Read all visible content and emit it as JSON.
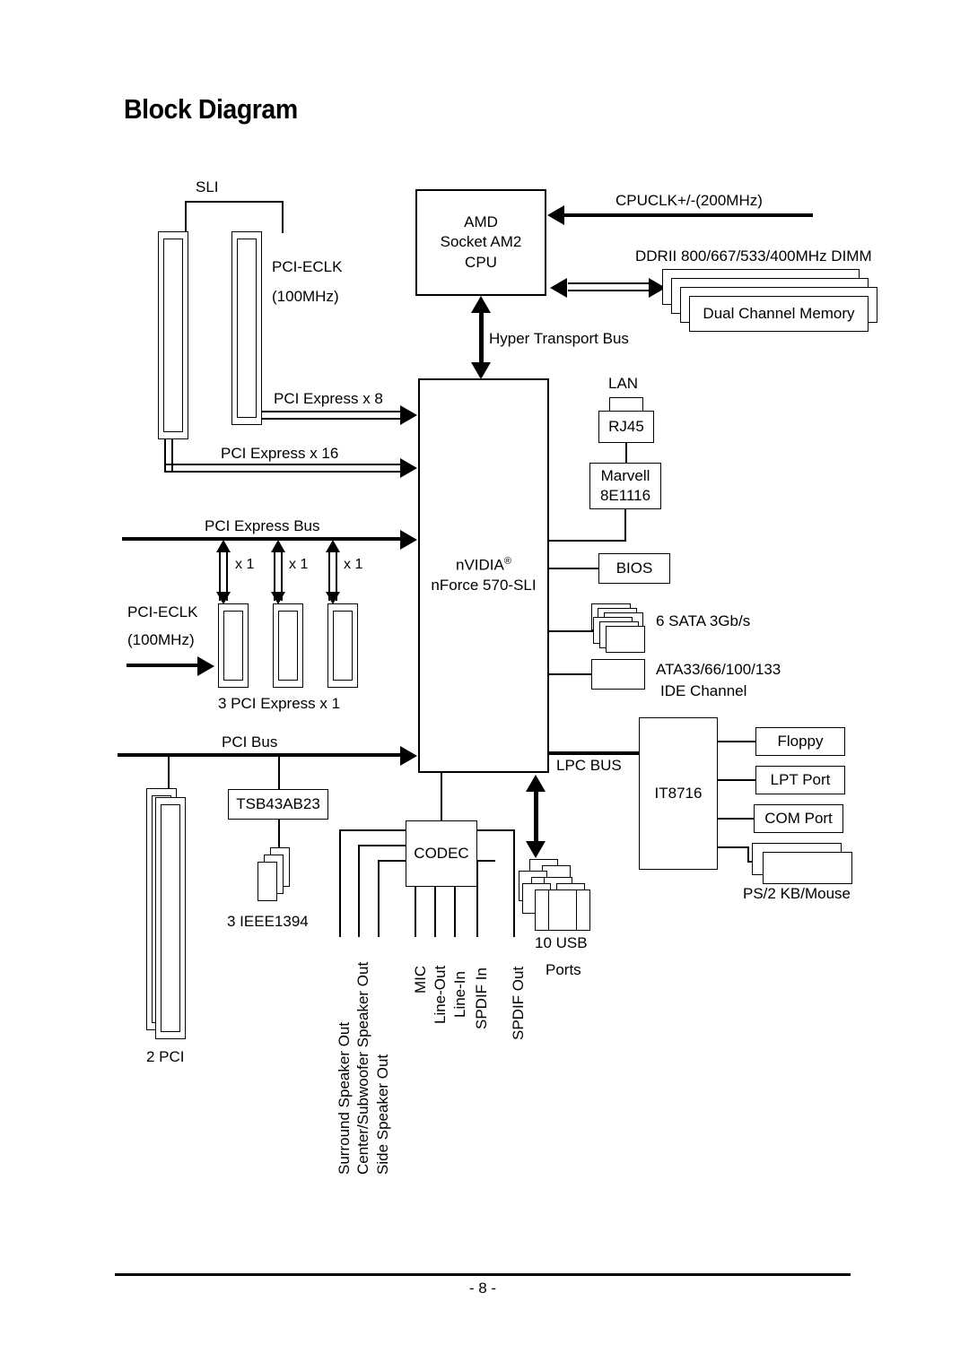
{
  "page": {
    "title": "Block Diagram",
    "footer_page_number": "- 8 -"
  },
  "diagram": {
    "cpu": {
      "line1": "AMD",
      "line2": "Socket AM2",
      "line3": "CPU"
    },
    "clock_in": "CPUCLK+/-(200MHz)",
    "memory": {
      "header": "DDRII 800/667/533/400MHz DIMM",
      "front_label": "Dual Channel Memory",
      "dimm_count": 4
    },
    "hyper_transport": "Hyper Transport Bus",
    "chipset": {
      "line1": "nVIDIA",
      "trademark": "®",
      "line2": "nForce 570-SLI"
    },
    "sli": {
      "bridge_label": "SLI",
      "eclk_line1": "PCI-ECLK",
      "eclk_line2": "(100MHz)",
      "link_x8": "PCI Express x 8",
      "link_x16": "PCI Express x 16"
    },
    "pcie_bus": {
      "bus_label": "PCI Express Bus",
      "lane_labels": [
        "x 1",
        "x 1",
        "x 1"
      ],
      "eclk_line1": "PCI-ECLK",
      "eclk_line2": "(100MHz)",
      "slots_label": "3 PCI Express x 1"
    },
    "pci_bus": {
      "bus_label": "PCI Bus",
      "slots_label": "2 PCI",
      "firewire_chip": "TSB43AB23",
      "firewire_ports": "3 IEEE1394"
    },
    "lan": {
      "title": "LAN",
      "rj45": "RJ45",
      "phy_line1": "Marvell",
      "phy_line2": "8E1116"
    },
    "bios": "BIOS",
    "sata": "6 SATA 3Gb/s",
    "ide": {
      "line1": "ATA33/66/100/133",
      "line2": "IDE Channel"
    },
    "lpc": {
      "bus_label": "LPC BUS",
      "superio": "IT8716",
      "floppy": "Floppy",
      "lpt": "LPT Port",
      "com": "COM Port",
      "ps2": "PS/2 KB/Mouse"
    },
    "usb": {
      "line1": "10 USB",
      "line2": "Ports"
    },
    "codec": {
      "title": "CODEC",
      "ports": [
        "Surround Speaker Out",
        "Center/Subwoofer Speaker Out",
        "Side Speaker Out",
        "MIC",
        "Line-Out",
        "Line-In",
        "SPDIF In",
        "SPDIF Out"
      ]
    }
  }
}
